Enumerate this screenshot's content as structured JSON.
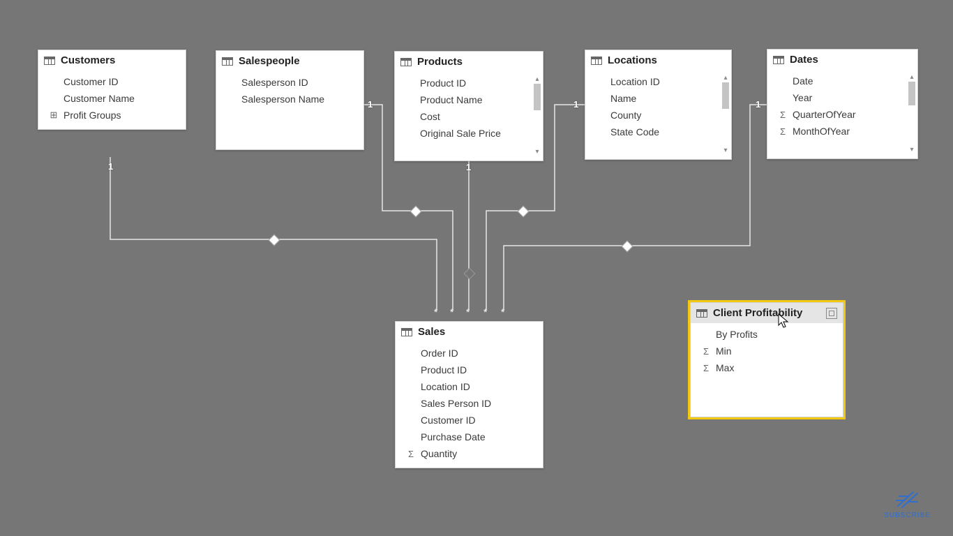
{
  "tables": {
    "customers": {
      "title": "Customers",
      "fields": [
        "Customer ID",
        "Customer Name",
        "Profit Groups"
      ],
      "profit_groups_icon": "calc"
    },
    "salespeople": {
      "title": "Salespeople",
      "fields": [
        "Salesperson ID",
        "Salesperson Name"
      ]
    },
    "products": {
      "title": "Products",
      "fields": [
        "Product ID",
        "Product Name",
        "Cost",
        "Original Sale Price"
      ],
      "has_scroll": true
    },
    "locations": {
      "title": "Locations",
      "fields": [
        "Location ID",
        "Name",
        "County",
        "State Code"
      ],
      "has_scroll": true
    },
    "dates": {
      "title": "Dates",
      "fields": [
        "Date",
        "Year",
        "QuarterOfYear",
        "MonthOfYear"
      ],
      "sigma": [
        false,
        false,
        true,
        true
      ],
      "has_scroll": true
    },
    "sales": {
      "title": "Sales",
      "fields": [
        "Order ID",
        "Product ID",
        "Location ID",
        "Sales Person ID",
        "Customer ID",
        "Purchase Date",
        "Quantity"
      ],
      "sigma": [
        false,
        false,
        false,
        false,
        false,
        false,
        true
      ]
    },
    "client_profitability": {
      "title": "Client Profitability",
      "fields": [
        "By Profits",
        "Min",
        "Max"
      ],
      "sigma": [
        false,
        true,
        true
      ],
      "selected": true
    }
  },
  "relationships": {
    "cardinality_one": "1",
    "cardinality_many": "*",
    "edges": [
      {
        "from": "customers",
        "to": "sales"
      },
      {
        "from": "salespeople",
        "to": "sales"
      },
      {
        "from": "products",
        "to": "sales"
      },
      {
        "from": "locations",
        "to": "sales"
      },
      {
        "from": "dates",
        "to": "sales"
      }
    ]
  },
  "watermark": {
    "label": "SUBSCRIBE"
  }
}
